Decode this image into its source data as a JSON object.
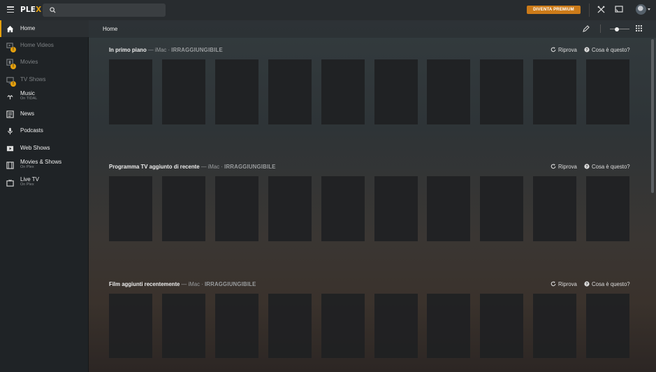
{
  "topbar": {
    "logo_prefix": "PLE",
    "logo_suffix": "X",
    "search_placeholder": "",
    "premium_label": "DIVENTA PREMIUM",
    "icons": [
      "menu-icon",
      "search-icon",
      "activity-icon",
      "cast-icon",
      "avatar"
    ]
  },
  "sidebar": {
    "items": [
      {
        "label": "Home",
        "sub": "",
        "icon": "home-icon",
        "active": true,
        "warning": false
      },
      {
        "label": "Home Videos",
        "sub": "",
        "icon": "home-videos-icon",
        "active": false,
        "warning": true
      },
      {
        "label": "Movies",
        "sub": "",
        "icon": "movies-icon",
        "active": false,
        "warning": true
      },
      {
        "label": "TV Shows",
        "sub": "",
        "icon": "tv-shows-icon",
        "active": false,
        "warning": true
      },
      {
        "label": "Music",
        "sub": "On TIDAL",
        "icon": "music-icon",
        "active": false,
        "warning": false
      },
      {
        "label": "News",
        "sub": "",
        "icon": "news-icon",
        "active": false,
        "warning": false
      },
      {
        "label": "Podcasts",
        "sub": "",
        "icon": "podcasts-icon",
        "active": false,
        "warning": false
      },
      {
        "label": "Web Shows",
        "sub": "",
        "icon": "web-shows-icon",
        "active": false,
        "warning": false
      },
      {
        "label": "Movies & Shows",
        "sub": "On Plex",
        "icon": "film-icon",
        "active": false,
        "warning": false
      },
      {
        "label": "Live TV",
        "sub": "On Plex",
        "icon": "live-tv-icon",
        "active": false,
        "warning": false
      }
    ],
    "warning_glyph": "!"
  },
  "main": {
    "title": "Home",
    "hubs": [
      {
        "title": "In primo piano",
        "sep": " — ",
        "server": "iMac",
        "dot": " · ",
        "status": "IRRAGGIUNGIBILE",
        "retry": "Riprova",
        "help": "Cosa è questo?"
      },
      {
        "title": "Programma TV aggiunto di recente",
        "sep": " — ",
        "server": "iMac",
        "dot": " · ",
        "status": "IRRAGGIUNGIBILE",
        "retry": "Riprova",
        "help": "Cosa è questo?"
      },
      {
        "title": "Film aggiunti recentemente",
        "sep": " — ",
        "server": "iMac",
        "dot": " · ",
        "status": "IRRAGGIUNGIBILE",
        "retry": "Riprova",
        "help": "Cosa è questo?"
      }
    ]
  },
  "colors": {
    "accent": "#e5a00d",
    "premium": "#cc7b19",
    "background": "#1f2326",
    "topbar": "#282c2f"
  }
}
